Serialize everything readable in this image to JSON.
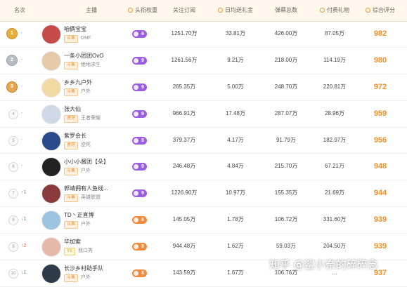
{
  "headers": {
    "rank": "名次",
    "anchor": "主播",
    "level": "头衔权重",
    "follow": "关注订阅",
    "gift": "日均送礼金",
    "danmu": "弹幕总数",
    "pay": "付费礼物",
    "score": "综合评分"
  },
  "rows": [
    {
      "rank": "1",
      "medal": "gold",
      "trend": "-",
      "trend_dir": "none",
      "name": "咱俩宝宝",
      "platform": "斗鱼",
      "category": "DNF",
      "level": "9",
      "level_color": "purple",
      "follow": "1251.70万",
      "gift": "33.81万",
      "danmu": "426.00万",
      "pay": "87.05万",
      "score": "982",
      "avatar_color": "#c74a4a"
    },
    {
      "rank": "2",
      "medal": "silver",
      "trend": "-",
      "trend_dir": "none",
      "name": "一条小团团OvO",
      "platform": "斗鱼",
      "category": "绝地求生",
      "level": "9",
      "level_color": "purple",
      "follow": "1261.56万",
      "gift": "9.21万",
      "danmu": "218.00万",
      "pay": "114.19万",
      "score": "980",
      "avatar_color": "#e6c9a8"
    },
    {
      "rank": "3",
      "medal": "bronze",
      "trend": "-",
      "trend_dir": "none",
      "name": "乡乡九户外",
      "platform": "斗鱼",
      "category": "户外",
      "level": "9",
      "level_color": "purple",
      "follow": "265.35万",
      "gift": "5.00万",
      "danmu": "248.70万",
      "pay": "220.81万",
      "score": "972",
      "avatar_color": "#f0d9a3"
    },
    {
      "rank": "4",
      "medal": "",
      "trend": "-",
      "trend_dir": "none",
      "name": "张大仙",
      "platform": "虎牙",
      "category": "王者荣耀",
      "level": "9",
      "level_color": "purple",
      "follow": "966.91万",
      "gift": "17.48万",
      "danmu": "287.07万",
      "pay": "28.96万",
      "score": "959",
      "avatar_color": "#cfd8e6"
    },
    {
      "rank": "5",
      "medal": "",
      "trend": "-",
      "trend_dir": "none",
      "name": "紫罗会长",
      "platform": "虎牙",
      "category": "逆死",
      "level": "9",
      "level_color": "purple",
      "follow": "379.37万",
      "gift": "4.17万",
      "danmu": "91.79万",
      "pay": "182.97万",
      "score": "956",
      "avatar_color": "#2b4a8a"
    },
    {
      "rank": "6",
      "medal": "",
      "trend": "-",
      "trend_dir": "none",
      "name": "小小小酱团【朵】",
      "platform": "斗鱼",
      "category": "户外",
      "level": "9",
      "level_color": "purple",
      "follow": "246.48万",
      "gift": "4.84万",
      "danmu": "215.70万",
      "pay": "67.21万",
      "score": "948",
      "avatar_color": "#222222"
    },
    {
      "rank": "7",
      "medal": "",
      "trend": "↑1",
      "trend_dir": "down",
      "name": "郭靖拥有人鱼线...",
      "platform": "斗鱼",
      "category": "英雄联盟",
      "level": "9",
      "level_color": "purple",
      "follow": "1226.90万",
      "gift": "10.97万",
      "danmu": "155.35万",
      "pay": "21.69万",
      "score": "944",
      "avatar_color": "#8a3a3a"
    },
    {
      "rank": "8",
      "medal": "",
      "trend": "↓1",
      "trend_dir": "up",
      "name": "TD丶正直博",
      "platform": "斗鱼",
      "category": "户外",
      "level": "8",
      "level_color": "orange",
      "follow": "145.05万",
      "gift": "1.78万",
      "danmu": "106.72万",
      "pay": "331.60万",
      "score": "939",
      "avatar_color": "#9cc3e0"
    },
    {
      "rank": "9",
      "medal": "",
      "trend": "↑2",
      "trend_dir": "down",
      "name": "毕加索",
      "platform": "YY",
      "category": "我口秀",
      "level": "8",
      "level_color": "orange",
      "follow": "944.48万",
      "gift": "1.62万",
      "danmu": "59.03万",
      "pay": "204.50万",
      "score": "939",
      "avatar_color": "#e8b8a8"
    },
    {
      "rank": "10",
      "medal": "",
      "trend": "↓1",
      "trend_dir": "up",
      "name": "长沙乡村助手队",
      "platform": "斗鱼",
      "category": "户外",
      "level": "8",
      "level_color": "orange",
      "follow": "143.59万",
      "gift": "1.67万",
      "danmu": "106.76万",
      "pay": "...",
      "score": "937",
      "avatar_color": "#2d3a4a"
    }
  ],
  "watermark": "知乎 @鲨小奈的碎碎念"
}
